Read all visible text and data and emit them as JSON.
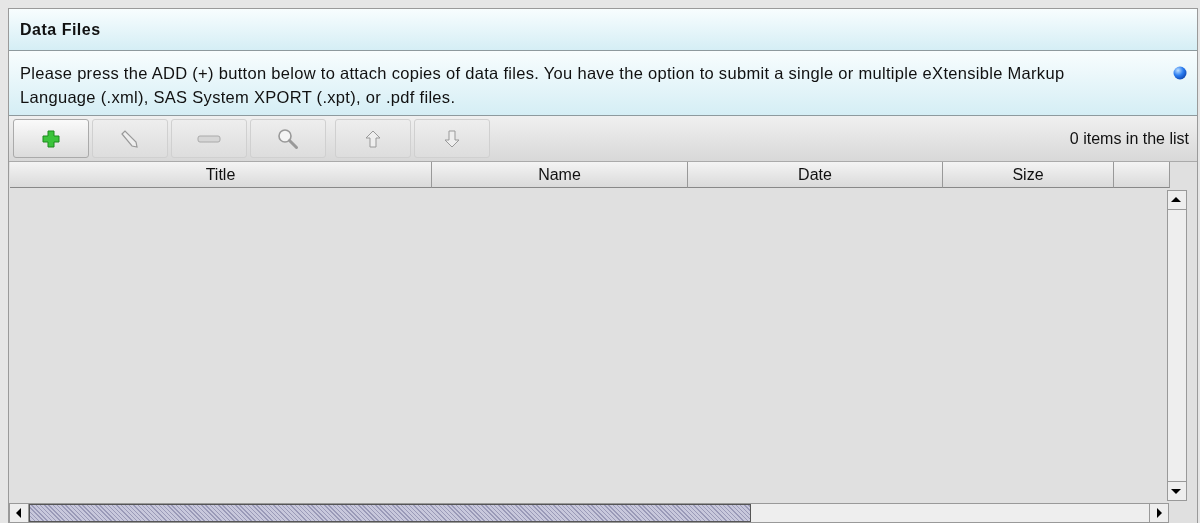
{
  "panel": {
    "title": "Data Files",
    "description": "Please press the ADD (+) button below to attach copies of data files. You have the option to submit a single or multiple eXtensible Markup Language (.xml), SAS System XPORT (.xpt), or .pdf files."
  },
  "toolbar": {
    "buttons": [
      {
        "kind": "add",
        "disabled": false
      },
      {
        "kind": "edit",
        "disabled": true
      },
      {
        "kind": "remove",
        "disabled": true
      },
      {
        "kind": "view",
        "disabled": true
      },
      {
        "kind": "up",
        "disabled": true
      },
      {
        "kind": "down",
        "disabled": true
      }
    ],
    "count": "0 items in the list"
  },
  "table": {
    "columns": [
      "Title",
      "Name",
      "Date",
      "Size"
    ]
  }
}
